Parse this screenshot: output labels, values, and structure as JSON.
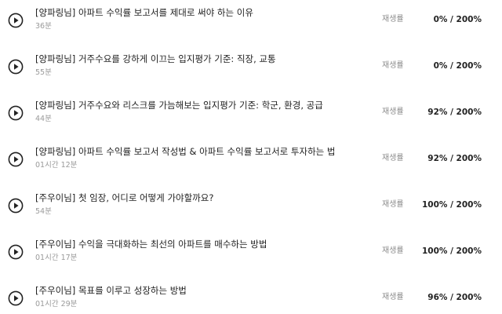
{
  "lessons": [
    {
      "title": "[양파링님] 아파트 수익률 보고서를 제대로 써야 하는 이유",
      "duration": "36분",
      "progress_label": "재생률",
      "progress": "0% / 200%"
    },
    {
      "title": "[양파링님] 거주수요를 강하게 이끄는 입지평가 기준: 직장, 교통",
      "duration": "55분",
      "progress_label": "재생률",
      "progress": "0% / 200%"
    },
    {
      "title": "[양파링님] 거주수요와 리스크를 가늠해보는 입지평가 기준: 학군, 환경, 공급",
      "duration": "44분",
      "progress_label": "재생률",
      "progress": "92% / 200%"
    },
    {
      "title": "[양파링님] 아파트 수익률 보고서 작성법 & 아파트 수익률 보고서로 투자하는 법",
      "duration": "01시간 12분",
      "progress_label": "재생률",
      "progress": "92% / 200%"
    },
    {
      "title": "[주우이님] 첫 임장, 어디로 어떻게 가야할까요?",
      "duration": "54분",
      "progress_label": "재생률",
      "progress": "100% / 200%"
    },
    {
      "title": "[주우이님] 수익을 극대화하는 최선의 아파트를 매수하는 방법",
      "duration": "01시간 17분",
      "progress_label": "재생률",
      "progress": "100% / 200%"
    },
    {
      "title": "[주우이님] 목표를 이루고 성장하는 방법",
      "duration": "01시간 29분",
      "progress_label": "재생률",
      "progress": "96% / 200%"
    }
  ]
}
